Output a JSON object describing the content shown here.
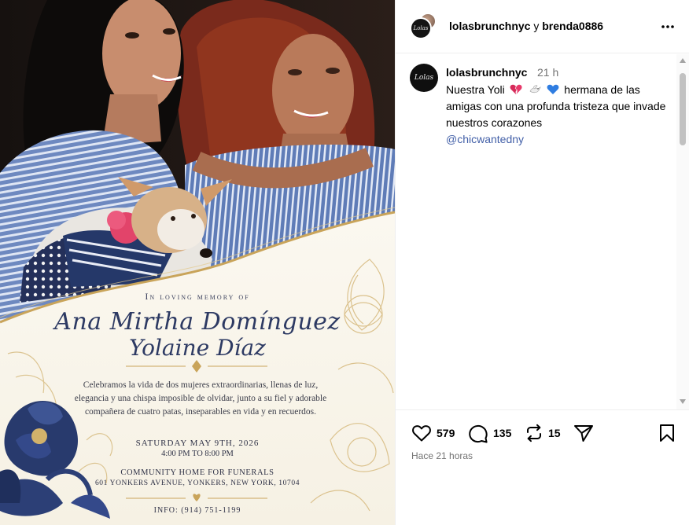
{
  "post_image": {
    "invite": {
      "memory_line": "In loving memory of",
      "name_line1": "Ana Mirtha Domínguez",
      "name_line2": "Yolaine Díaz",
      "body": "Celebramos la vida de dos mujeres extraordinarias, llenas de luz, elegancia y una chispa imposible de olvidar, junto a su fiel y adorable compañera de cuatro patas, inseparables en vida y en recuerdos.",
      "date": "SATURDAY MAY 9TH, 2026",
      "time": "4:00 PM TO 8:00 PM",
      "venue": "COMMUNITY HOME FOR FUNERALS",
      "address": "601 YONKERS AVENUE, YONKERS, NEW YORK, 10704",
      "info": "INFO: (914) 751-1199"
    }
  },
  "header": {
    "user1": "lolasbrunchnyc",
    "conjunction": "y",
    "user2": "brenda0886",
    "more_icon": "more-horizontal-icon"
  },
  "caption": {
    "username": "lolasbrunchnyc",
    "time": "21 h",
    "text_before": "Nuestra Yoli",
    "text_after": "hermana  de las amigas con una profunda tristeza que invade nuestros corazones",
    "mention": "@chicwantedny",
    "emojis": [
      "broken-heart-emoji",
      "dove-emoji",
      "blue-heart-emoji"
    ]
  },
  "actions": {
    "like_count": "579",
    "comment_count": "135",
    "repost_count": "15",
    "time_ago": "Hace 21 horas"
  },
  "colors": {
    "mention": "#4360a8",
    "muted_text": "#737373",
    "border": "#efefef"
  }
}
